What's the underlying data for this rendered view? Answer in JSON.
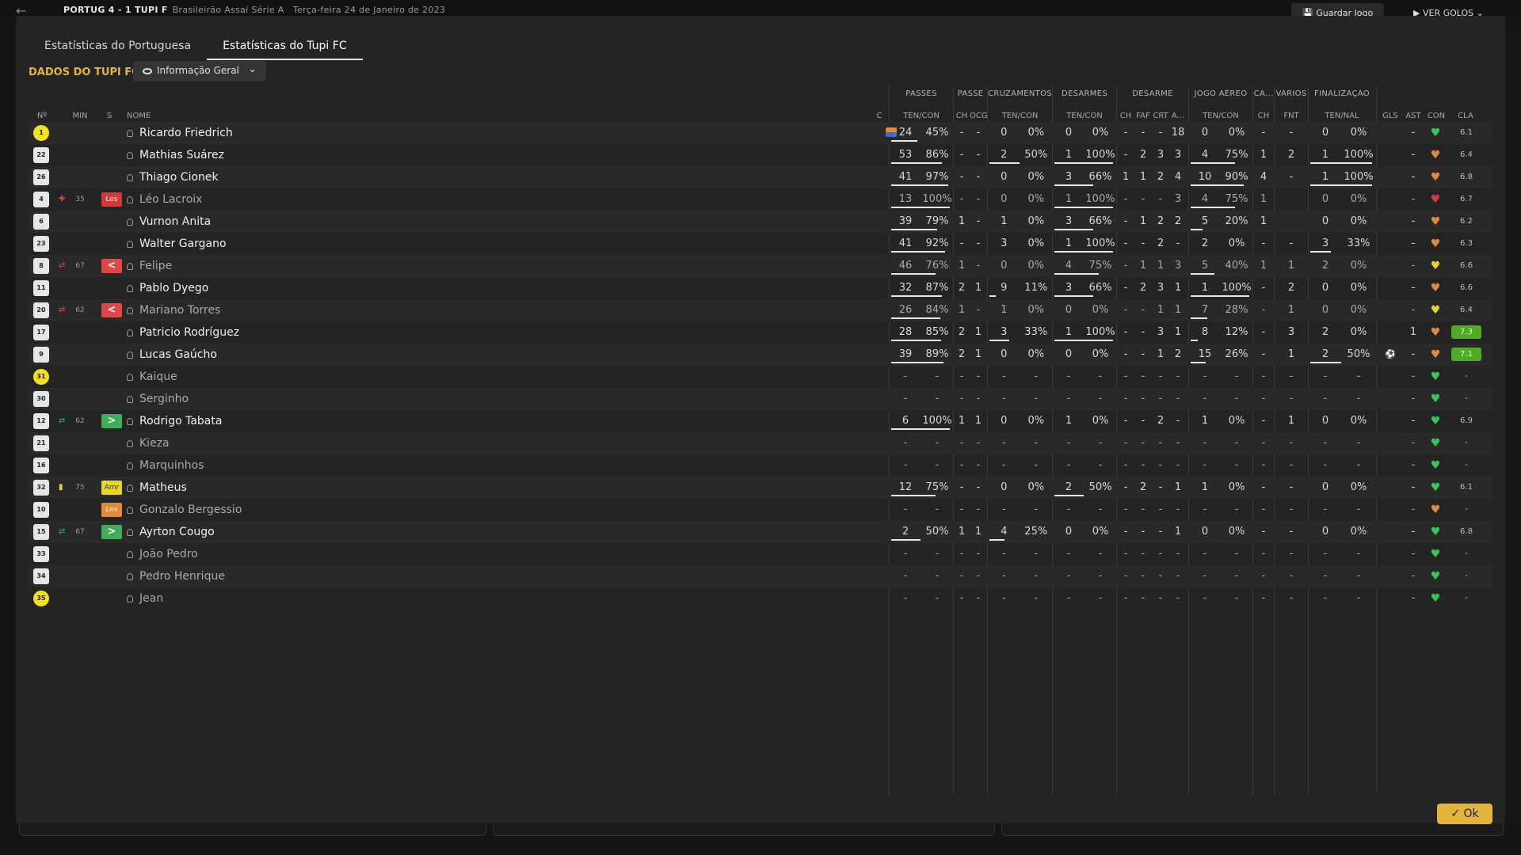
{
  "topbar": {
    "back_icon": "arrow-left-icon",
    "score": "PORTUG 4 - 1 TUPI F",
    "competition": "Brasileirão Assaí Série A",
    "date": "Terça-feira 24 de Janeiro de 2023",
    "save_label": "Guardar Jogo",
    "goals_label": "VER GOLOS"
  },
  "tabs": [
    {
      "label": "Estatísticas do Portuguesa"
    },
    {
      "label": "Estatísticas do Tupi FC",
      "active": true
    }
  ],
  "section_label": "DADOS DO TUPI FC",
  "view_select": {
    "value": "Informação Geral"
  },
  "group_headers": [
    "PASSES",
    "PASSE",
    "CRUZAMENTOS",
    "DESARMES",
    "DESARME",
    "JOGO AÉREO",
    "CA...",
    "VÁRIOS",
    "FINALIZAÇÃO"
  ],
  "columns": {
    "num": "Nº",
    "min": "MIN",
    "s": "S",
    "name": "NOME",
    "c": "C",
    "passes": "TEN/CON",
    "passe_ch": "CH",
    "passe_ocg": "OCG",
    "cruz": "TEN/CON",
    "des": "TEN/CON",
    "des_ch": "CH",
    "des_faf": "FAF",
    "des_crt": "CRT",
    "des_a": "A...",
    "aereo": "TEN/CON",
    "ca_ch": "CH",
    "var_fnt": "FNT",
    "fin": "TEN/NAL",
    "gls": "GLS",
    "ast": "AST",
    "con": "CON",
    "cla": "CLA"
  },
  "players": [
    {
      "num": "1",
      "gk": true,
      "name": "Ricardo Friedrich",
      "min": "",
      "badge": "",
      "captain": true,
      "pass": [
        "24",
        "45%"
      ],
      "pass_fill": 0.45,
      "ch": "-",
      "ocg": "-",
      "cruz": [
        "0",
        "0%"
      ],
      "cruz_fill": 0,
      "des": [
        "0",
        "0%"
      ],
      "des_fill": 0,
      "dch": "-",
      "faf": "-",
      "crt": "-",
      "da": "18",
      "aer": [
        "0",
        "0%"
      ],
      "aer_fill": 0,
      "cach": "-",
      "fnt": "-",
      "fin": [
        "0",
        "0%"
      ],
      "fin_fill": 0,
      "gls": "",
      "ast": "-",
      "con": "green",
      "cla": "6.1",
      "hi": false,
      "dim": false
    },
    {
      "num": "22",
      "gk": false,
      "name": "Mathias Suárez",
      "min": "",
      "badge": "",
      "pass": [
        "53",
        "86%"
      ],
      "pass_fill": 0.86,
      "ch": "-",
      "ocg": "-",
      "cruz": [
        "2",
        "50%"
      ],
      "cruz_fill": 0.5,
      "des": [
        "1",
        "100%"
      ],
      "des_fill": 1,
      "dch": "-",
      "faf": "2",
      "crt": "3",
      "da": "3",
      "aer": [
        "4",
        "75%"
      ],
      "aer_fill": 0.75,
      "cach": "1",
      "fnt": "2",
      "fin": [
        "1",
        "100%"
      ],
      "fin_fill": 1,
      "gls": "",
      "ast": "-",
      "con": "orange",
      "cla": "6.4",
      "hi": false,
      "dim": false
    },
    {
      "num": "26",
      "gk": false,
      "name": "Thiago Cionek",
      "min": "",
      "badge": "",
      "pass": [
        "41",
        "97%"
      ],
      "pass_fill": 0.97,
      "ch": "-",
      "ocg": "-",
      "cruz": [
        "0",
        "0%"
      ],
      "cruz_fill": 0,
      "des": [
        "3",
        "66%"
      ],
      "des_fill": 0.66,
      "dch": "1",
      "faf": "1",
      "crt": "2",
      "da": "4",
      "aer": [
        "10",
        "90%"
      ],
      "aer_fill": 0.9,
      "cach": "4",
      "fnt": "-",
      "fin": [
        "1",
        "100%"
      ],
      "fin_fill": 1,
      "gls": "",
      "ast": "-",
      "con": "orange",
      "cla": "6.8",
      "hi": false,
      "dim": false
    },
    {
      "num": "4",
      "gk": false,
      "name": "Léo Lacroix",
      "min": "35",
      "badge": "Les",
      "badge_cls": "bl",
      "ev": "injury",
      "pass": [
        "13",
        "100%"
      ],
      "pass_fill": 1,
      "ch": "-",
      "ocg": "-",
      "cruz": [
        "0",
        "0%"
      ],
      "cruz_fill": 0,
      "des": [
        "1",
        "100%"
      ],
      "des_fill": 1,
      "dch": "-",
      "faf": "-",
      "crt": "-",
      "da": "3",
      "aer": [
        "4",
        "75%"
      ],
      "aer_fill": 0.75,
      "cach": "1",
      "fnt": "",
      "fin": [
        "0",
        "0%"
      ],
      "fin_fill": 0,
      "gls": "",
      "ast": "-",
      "con": "red",
      "cla": "6.7",
      "hi": false,
      "dim": true
    },
    {
      "num": "6",
      "gk": false,
      "name": "Vurnon Anita",
      "min": "",
      "badge": "",
      "pass": [
        "39",
        "79%"
      ],
      "pass_fill": 0.79,
      "ch": "1",
      "ocg": "-",
      "cruz": [
        "1",
        "0%"
      ],
      "cruz_fill": 0,
      "des": [
        "3",
        "66%"
      ],
      "des_fill": 0.66,
      "dch": "-",
      "faf": "1",
      "crt": "2",
      "da": "2",
      "aer": [
        "5",
        "20%"
      ],
      "aer_fill": 0.2,
      "cach": "1",
      "fnt": "",
      "fin": [
        "0",
        "0%"
      ],
      "fin_fill": 0,
      "gls": "",
      "ast": "-",
      "con": "orange",
      "cla": "6.2",
      "hi": false,
      "dim": false
    },
    {
      "num": "23",
      "gk": false,
      "name": "Walter Gargano",
      "min": "",
      "badge": "",
      "pass": [
        "41",
        "92%"
      ],
      "pass_fill": 0.92,
      "ch": "-",
      "ocg": "-",
      "cruz": [
        "3",
        "0%"
      ],
      "cruz_fill": 0,
      "des": [
        "1",
        "100%"
      ],
      "des_fill": 1,
      "dch": "-",
      "faf": "-",
      "crt": "2",
      "da": "-",
      "aer": [
        "2",
        "0%"
      ],
      "aer_fill": 0,
      "cach": "-",
      "fnt": "-",
      "fin": [
        "3",
        "33%"
      ],
      "fin_fill": 0.33,
      "gls": "",
      "ast": "-",
      "con": "orange",
      "cla": "6.3",
      "hi": false,
      "dim": false
    },
    {
      "num": "8",
      "gk": false,
      "name": "Felipe",
      "min": "67",
      "badge": "<",
      "badge_cls": "bsub-out",
      "ev": "sub-out",
      "pass": [
        "46",
        "76%"
      ],
      "pass_fill": 0.76,
      "ch": "1",
      "ocg": "-",
      "cruz": [
        "0",
        "0%"
      ],
      "cruz_fill": 0,
      "des": [
        "4",
        "75%"
      ],
      "des_fill": 0.75,
      "dch": "-",
      "faf": "1",
      "crt": "1",
      "da": "3",
      "aer": [
        "5",
        "40%"
      ],
      "aer_fill": 0.4,
      "cach": "1",
      "fnt": "1",
      "fin": [
        "2",
        "0%"
      ],
      "fin_fill": 0,
      "gls": "",
      "ast": "-",
      "con": "yellow",
      "cla": "6.6",
      "hi": false,
      "dim": true
    },
    {
      "num": "11",
      "gk": false,
      "name": "Pablo Dyego",
      "min": "",
      "badge": "",
      "pass": [
        "32",
        "87%"
      ],
      "pass_fill": 0.87,
      "ch": "2",
      "ocg": "1",
      "cruz": [
        "9",
        "11%"
      ],
      "cruz_fill": 0.11,
      "des": [
        "3",
        "66%"
      ],
      "des_fill": 0.66,
      "dch": "-",
      "faf": "2",
      "crt": "3",
      "da": "1",
      "aer": [
        "1",
        "100%"
      ],
      "aer_fill": 1,
      "cach": "-",
      "fnt": "2",
      "fin": [
        "0",
        "0%"
      ],
      "fin_fill": 0,
      "gls": "",
      "ast": "-",
      "con": "orange",
      "cla": "6.6",
      "hi": false,
      "dim": false
    },
    {
      "num": "20",
      "gk": false,
      "name": "Mariano Torres",
      "min": "62",
      "badge": "<",
      "badge_cls": "bsub-out",
      "ev": "sub-out",
      "pass": [
        "26",
        "84%"
      ],
      "pass_fill": 0.84,
      "ch": "1",
      "ocg": "-",
      "cruz": [
        "1",
        "0%"
      ],
      "cruz_fill": 0,
      "des": [
        "0",
        "0%"
      ],
      "des_fill": 0,
      "dch": "-",
      "faf": "-",
      "crt": "1",
      "da": "1",
      "aer": [
        "7",
        "28%"
      ],
      "aer_fill": 0.28,
      "cach": "-",
      "fnt": "1",
      "fin": [
        "0",
        "0%"
      ],
      "fin_fill": 0,
      "gls": "",
      "ast": "-",
      "con": "yellow",
      "cla": "6.4",
      "hi": false,
      "dim": true
    },
    {
      "num": "17",
      "gk": false,
      "name": "Patricio Rodríguez",
      "min": "",
      "badge": "",
      "pass": [
        "28",
        "85%"
      ],
      "pass_fill": 0.85,
      "ch": "2",
      "ocg": "1",
      "cruz": [
        "3",
        "33%"
      ],
      "cruz_fill": 0.33,
      "des": [
        "1",
        "100%"
      ],
      "des_fill": 1,
      "dch": "-",
      "faf": "-",
      "crt": "3",
      "da": "1",
      "aer": [
        "8",
        "12%"
      ],
      "aer_fill": 0.12,
      "cach": "-",
      "fnt": "3",
      "fin": [
        "2",
        "0%"
      ],
      "fin_fill": 0,
      "gls": "",
      "ast": "1",
      "con": "orange",
      "cla": "7.3",
      "hi": true,
      "dim": false
    },
    {
      "num": "9",
      "gk": false,
      "name": "Lucas Gaúcho",
      "min": "",
      "badge": "",
      "pass": [
        "39",
        "89%"
      ],
      "pass_fill": 0.89,
      "ch": "2",
      "ocg": "1",
      "cruz": [
        "0",
        "0%"
      ],
      "cruz_fill": 0,
      "des": [
        "0",
        "0%"
      ],
      "des_fill": 0,
      "dch": "-",
      "faf": "-",
      "crt": "1",
      "da": "2",
      "aer": [
        "15",
        "26%"
      ],
      "aer_fill": 0.26,
      "cach": "-",
      "fnt": "1",
      "fin": [
        "2",
        "50%"
      ],
      "fin_fill": 0.5,
      "gls": "⚽",
      "ast": "-",
      "con": "orange",
      "cla": "7.1",
      "hi": true,
      "dim": false
    },
    {
      "num": "31",
      "gk": true,
      "name": "Kaique",
      "min": "",
      "badge": "",
      "pass": [
        "-",
        "-"
      ],
      "pass_fill": 0,
      "ch": "-",
      "ocg": "-",
      "cruz": [
        "-",
        "-"
      ],
      "cruz_fill": 0,
      "des": [
        "-",
        "-"
      ],
      "des_fill": 0,
      "dch": "-",
      "faf": "-",
      "crt": "-",
      "da": "-",
      "aer": [
        "-",
        "-"
      ],
      "aer_fill": 0,
      "cach": "-",
      "fnt": "-",
      "fin": [
        "-",
        "-"
      ],
      "fin_fill": 0,
      "gls": "",
      "ast": "-",
      "con": "green",
      "cla": "-",
      "hi": false,
      "dim": true
    },
    {
      "num": "30",
      "gk": false,
      "name": "Serginho",
      "min": "",
      "badge": "",
      "pass": [
        "-",
        "-"
      ],
      "pass_fill": 0,
      "ch": "-",
      "ocg": "-",
      "cruz": [
        "-",
        "-"
      ],
      "cruz_fill": 0,
      "des": [
        "-",
        "-"
      ],
      "des_fill": 0,
      "dch": "-",
      "faf": "-",
      "crt": "-",
      "da": "-",
      "aer": [
        "-",
        "-"
      ],
      "aer_fill": 0,
      "cach": "-",
      "fnt": "-",
      "fin": [
        "-",
        "-"
      ],
      "fin_fill": 0,
      "gls": "",
      "ast": "-",
      "con": "green",
      "cla": "-",
      "hi": false,
      "dim": true
    },
    {
      "num": "12",
      "gk": false,
      "name": "Rodrigo Tabata",
      "min": "62",
      "badge": ">",
      "badge_cls": "bsub-in",
      "ev": "sub-in",
      "pass": [
        "6",
        "100%"
      ],
      "pass_fill": 1,
      "ch": "1",
      "ocg": "1",
      "cruz": [
        "0",
        "0%"
      ],
      "cruz_fill": 0,
      "des": [
        "1",
        "0%"
      ],
      "des_fill": 0,
      "dch": "-",
      "faf": "-",
      "crt": "2",
      "da": "-",
      "aer": [
        "1",
        "0%"
      ],
      "aer_fill": 0,
      "cach": "-",
      "fnt": "1",
      "fin": [
        "0",
        "0%"
      ],
      "fin_fill": 0,
      "gls": "",
      "ast": "-",
      "con": "green",
      "cla": "6.9",
      "hi": false,
      "dim": false
    },
    {
      "num": "21",
      "gk": false,
      "name": "Kieza",
      "min": "",
      "badge": "",
      "pass": [
        "-",
        "-"
      ],
      "pass_fill": 0,
      "ch": "-",
      "ocg": "-",
      "cruz": [
        "-",
        "-"
      ],
      "cruz_fill": 0,
      "des": [
        "-",
        "-"
      ],
      "des_fill": 0,
      "dch": "-",
      "faf": "-",
      "crt": "-",
      "da": "-",
      "aer": [
        "-",
        "-"
      ],
      "aer_fill": 0,
      "cach": "-",
      "fnt": "-",
      "fin": [
        "-",
        "-"
      ],
      "fin_fill": 0,
      "gls": "",
      "ast": "-",
      "con": "green",
      "cla": "-",
      "hi": false,
      "dim": true
    },
    {
      "num": "16",
      "gk": false,
      "name": "Marquinhos",
      "min": "",
      "badge": "",
      "pass": [
        "-",
        "-"
      ],
      "pass_fill": 0,
      "ch": "-",
      "ocg": "-",
      "cruz": [
        "-",
        "-"
      ],
      "cruz_fill": 0,
      "des": [
        "-",
        "-"
      ],
      "des_fill": 0,
      "dch": "-",
      "faf": "-",
      "crt": "-",
      "da": "-",
      "aer": [
        "-",
        "-"
      ],
      "aer_fill": 0,
      "cach": "-",
      "fnt": "-",
      "fin": [
        "-",
        "-"
      ],
      "fin_fill": 0,
      "gls": "",
      "ast": "-",
      "con": "green",
      "cla": "-",
      "hi": false,
      "dim": true
    },
    {
      "num": "32",
      "gk": false,
      "name": "Matheus",
      "min": "75",
      "badge": "Amr",
      "badge_cls": "ba",
      "ev": "yellow-card",
      "pass": [
        "12",
        "75%"
      ],
      "pass_fill": 0.75,
      "ch": "-",
      "ocg": "-",
      "cruz": [
        "0",
        "0%"
      ],
      "cruz_fill": 0,
      "des": [
        "2",
        "50%"
      ],
      "des_fill": 0.5,
      "dch": "-",
      "faf": "2",
      "crt": "-",
      "da": "1",
      "aer": [
        "1",
        "0%"
      ],
      "aer_fill": 0,
      "cach": "-",
      "fnt": "-",
      "fin": [
        "0",
        "0%"
      ],
      "fin_fill": 0,
      "gls": "",
      "ast": "-",
      "con": "green",
      "cla": "6.1",
      "hi": false,
      "dim": false
    },
    {
      "num": "10",
      "gk": false,
      "name": "Gonzalo Bergessio",
      "min": "",
      "badge": "Les",
      "badge_cls": "bo",
      "pass": [
        "-",
        "-"
      ],
      "pass_fill": 0,
      "ch": "-",
      "ocg": "-",
      "cruz": [
        "-",
        "-"
      ],
      "cruz_fill": 0,
      "des": [
        "-",
        "-"
      ],
      "des_fill": 0,
      "dch": "-",
      "faf": "-",
      "crt": "-",
      "da": "-",
      "aer": [
        "-",
        "-"
      ],
      "aer_fill": 0,
      "cach": "-",
      "fnt": "-",
      "fin": [
        "-",
        "-"
      ],
      "fin_fill": 0,
      "gls": "",
      "ast": "-",
      "con": "orange",
      "cla": "-",
      "hi": false,
      "dim": true
    },
    {
      "num": "15",
      "gk": false,
      "name": "Ayrton Cougo",
      "min": "67",
      "badge": ">",
      "badge_cls": "bsub-in",
      "ev": "sub-in",
      "pass": [
        "2",
        "50%"
      ],
      "pass_fill": 0.5,
      "ch": "1",
      "ocg": "1",
      "cruz": [
        "4",
        "25%"
      ],
      "cruz_fill": 0.25,
      "des": [
        "0",
        "0%"
      ],
      "des_fill": 0,
      "dch": "-",
      "faf": "-",
      "crt": "-",
      "da": "1",
      "aer": [
        "0",
        "0%"
      ],
      "aer_fill": 0,
      "cach": "-",
      "fnt": "-",
      "fin": [
        "0",
        "0%"
      ],
      "fin_fill": 0,
      "gls": "",
      "ast": "-",
      "con": "green",
      "cla": "6.8",
      "hi": false,
      "dim": false
    },
    {
      "num": "33",
      "gk": false,
      "name": "João Pedro",
      "min": "",
      "badge": "",
      "pass": [
        "-",
        "-"
      ],
      "pass_fill": 0,
      "ch": "-",
      "ocg": "-",
      "cruz": [
        "-",
        "-"
      ],
      "cruz_fill": 0,
      "des": [
        "-",
        "-"
      ],
      "des_fill": 0,
      "dch": "-",
      "faf": "-",
      "crt": "-",
      "da": "-",
      "aer": [
        "-",
        "-"
      ],
      "aer_fill": 0,
      "cach": "-",
      "fnt": "-",
      "fin": [
        "-",
        "-"
      ],
      "fin_fill": 0,
      "gls": "",
      "ast": "-",
      "con": "green",
      "cla": "-",
      "hi": false,
      "dim": true
    },
    {
      "num": "34",
      "gk": false,
      "name": "Pedro Henrique",
      "min": "",
      "badge": "",
      "pass": [
        "-",
        "-"
      ],
      "pass_fill": 0,
      "ch": "-",
      "ocg": "-",
      "cruz": [
        "-",
        "-"
      ],
      "cruz_fill": 0,
      "des": [
        "-",
        "-"
      ],
      "des_fill": 0,
      "dch": "-",
      "faf": "-",
      "crt": "-",
      "da": "-",
      "aer": [
        "-",
        "-"
      ],
      "aer_fill": 0,
      "cach": "-",
      "fnt": "-",
      "fin": [
        "-",
        "-"
      ],
      "fin_fill": 0,
      "gls": "",
      "ast": "-",
      "con": "green",
      "cla": "-",
      "hi": false,
      "dim": true
    },
    {
      "num": "35",
      "gk": true,
      "name": "Jean",
      "min": "",
      "badge": "",
      "pass": [
        "-",
        "-"
      ],
      "pass_fill": 0,
      "ch": "-",
      "ocg": "-",
      "cruz": [
        "-",
        "-"
      ],
      "cruz_fill": 0,
      "des": [
        "-",
        "-"
      ],
      "des_fill": 0,
      "dch": "-",
      "faf": "-",
      "crt": "-",
      "da": "-",
      "aer": [
        "-",
        "-"
      ],
      "aer_fill": 0,
      "cach": "-",
      "fnt": "-",
      "fin": [
        "-",
        "-"
      ],
      "fin_fill": 0,
      "gls": "",
      "ast": "-",
      "con": "green",
      "cla": "-",
      "hi": false,
      "dim": true
    }
  ],
  "colors": {
    "accent": "#e3b43c",
    "con_green": "#34c759",
    "con_orange": "#e08a3c",
    "con_yellow": "#e8d52a",
    "con_red": "#d23a3a"
  },
  "ok_label": "Ok"
}
